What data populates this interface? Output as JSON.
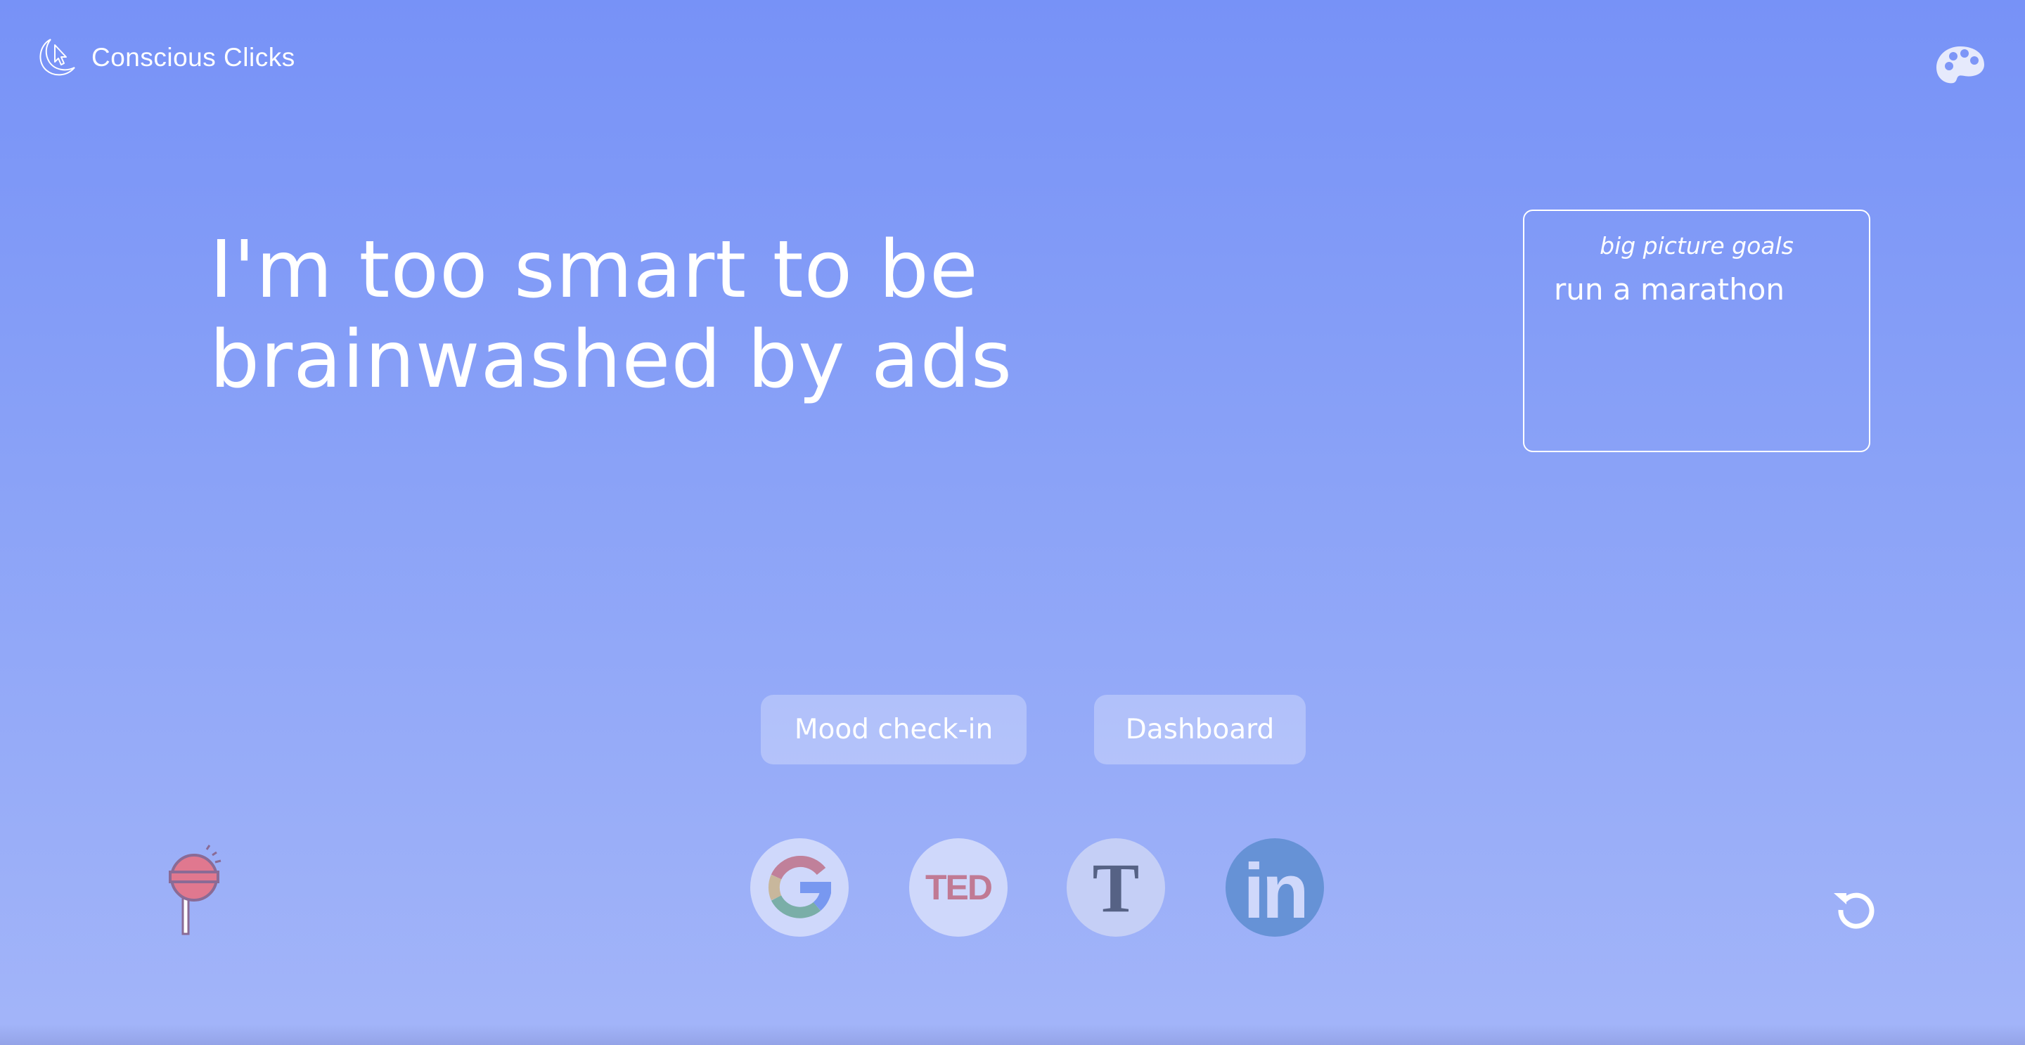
{
  "header": {
    "app_name": "Conscious Clicks",
    "logo_icon": "moon-cursor-icon",
    "theme_icon": "palette-icon"
  },
  "main": {
    "headline_line1": "I'm too smart to be",
    "headline_line2": "brainwashed by ads"
  },
  "goals": {
    "title": "big picture goals",
    "items": [
      "run a marathon"
    ]
  },
  "actions": {
    "mood_label": "Mood check-in",
    "dashboard_label": "Dashboard"
  },
  "shortcuts": [
    {
      "name": "Google",
      "icon": "google-icon"
    },
    {
      "name": "TED",
      "text": "TED",
      "icon": "ted-icon"
    },
    {
      "name": "The New York Times",
      "text": "T",
      "icon": "nyt-icon"
    },
    {
      "name": "LinkedIn",
      "text": "in",
      "icon": "linkedin-icon"
    }
  ],
  "footer": {
    "left_icon": "lollipop-icon",
    "right_icon": "reset-icon"
  },
  "colors": {
    "bg_top": "#7792f7",
    "bg_bottom": "#a3b5f9",
    "ted_red": "#c07a94",
    "linkedin_blue": "#6692d6",
    "nyt_dark": "#566285"
  }
}
